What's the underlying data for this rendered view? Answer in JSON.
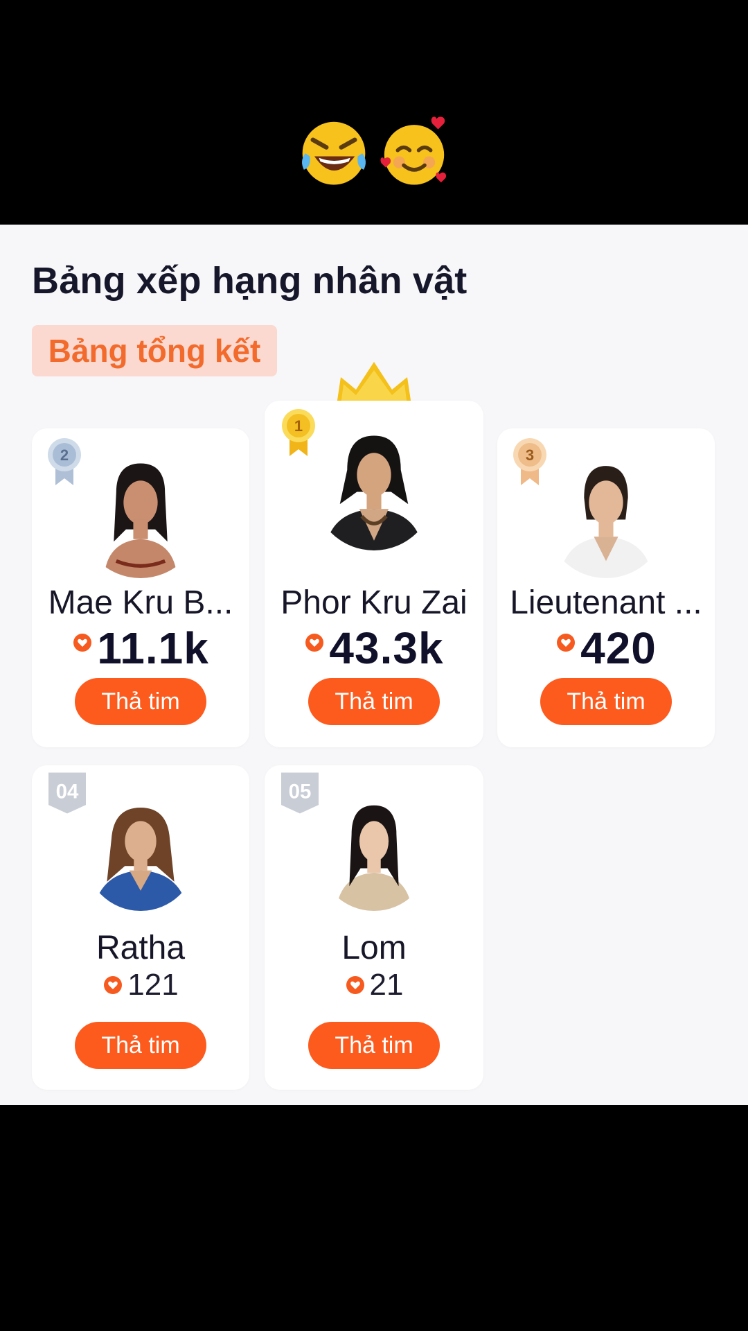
{
  "top_bar": {
    "emojis": [
      "rolling-on-floor-laughing",
      "smiling-face-with-hearts"
    ]
  },
  "panel": {
    "title": "Bảng xếp hạng nhân vật",
    "active_tab": "Bảng tổng kết"
  },
  "ranking": [
    {
      "rank": "1",
      "name": "Phor Kru Zai",
      "votes": "43.3k",
      "vote_button": "Thả tim"
    },
    {
      "rank": "2",
      "name": "Mae Kru B...",
      "votes": "11.1k",
      "vote_button": "Thả tim"
    },
    {
      "rank": "3",
      "name": "Lieutenant ...",
      "votes": "420",
      "vote_button": "Thả tim"
    },
    {
      "rank": "04",
      "name": "Ratha",
      "votes": "121",
      "vote_button": "Thả tim"
    },
    {
      "rank": "05",
      "name": "Lom",
      "votes": "21",
      "vote_button": "Thả tim"
    }
  ],
  "colors": {
    "accent": "#fd5b1e",
    "tab_bg": "#fbd9d0",
    "tab_text": "#f26b2c",
    "gold": "#f5c21a",
    "silver": "#b9c7da",
    "bronze": "#f2c79a"
  },
  "icons": {
    "crown": "crown-icon",
    "heart": "heart-icon",
    "rank_badge": "medal-icon"
  }
}
